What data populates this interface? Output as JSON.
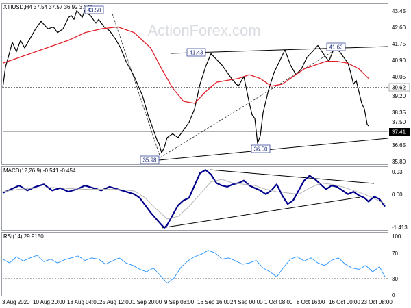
{
  "chart_data": {
    "type": "line",
    "watermark": "ActionForex.com",
    "x_tick_labels": [
      "3 Aug 2020",
      "10 Aug 20:00",
      "18 Aug 04:00",
      "25 Aug 12:00",
      "1 Sep 20:00",
      "9 Sep 08:00",
      "16 Sep 16:00",
      "24 Sep 00:00",
      "1 Oct 08:00",
      "8 Oct 16:00",
      "16 Oct 00:00",
      "23 Oct 08:00"
    ],
    "price_panel": {
      "header": "XTIUSD,H4  37.54 37.57 36.92 37.41",
      "ylim": [
        35.4,
        43.8
      ],
      "y_ticks": [
        "43.45",
        "42.60",
        "41.75",
        "40.90",
        "40.05",
        "39.20",
        "38.35",
        "37.50",
        "36.65",
        "35.80"
      ],
      "current_price_label": "37.41",
      "reference_level_label": "39.62",
      "annotations": [
        "43.50",
        "41.43",
        "41.63",
        "35.98",
        "36.50"
      ],
      "series": [
        {
          "color": "#000000",
          "x": [
            0,
            4,
            8,
            14,
            20,
            26,
            32,
            40,
            48,
            56,
            66,
            74,
            80,
            88,
            96,
            100,
            104,
            108,
            112,
            116,
            120,
            124,
            128,
            132,
            136,
            140,
            148,
            156,
            164,
            172,
            180,
            192,
            204,
            212,
            220,
            226,
            228,
            232,
            236,
            240,
            248,
            256,
            264,
            272,
            280,
            288,
            296,
            304,
            312,
            320,
            328,
            336,
            344,
            352,
            356,
            360,
            364,
            368,
            372,
            376,
            380,
            388,
            396,
            404,
            412,
            420,
            428,
            436,
            444,
            452,
            460,
            468,
            476,
            484,
            492,
            500,
            504,
            508,
            512,
            516,
            520,
            524,
            528,
            532,
            534
          ],
          "y": [
            39.4,
            40.5,
            41.0,
            41.8,
            41.3,
            41.9,
            41.5,
            42.0,
            42.5,
            42.9,
            42.5,
            42.6,
            42.3,
            42.5,
            43.1,
            43.2,
            43.0,
            43.45,
            43.3,
            43.1,
            43.5,
            43.3,
            43.2,
            43.0,
            42.8,
            43.0,
            42.6,
            42.4,
            42.0,
            41.5,
            40.8,
            40.0,
            39.0,
            38.0,
            37.2,
            36.6,
            36.5,
            36.0,
            36.3,
            36.8,
            37.0,
            36.8,
            37.2,
            37.6,
            38.3,
            39.6,
            40.5,
            41.2,
            40.9,
            40.6,
            40.2,
            39.8,
            39.5,
            40.0,
            39.3,
            38.6,
            38.0,
            37.8,
            36.5,
            36.9,
            38.1,
            39.3,
            40.2,
            40.8,
            41.4,
            40.6,
            40.1,
            40.4,
            41.0,
            41.3,
            41.63,
            41.2,
            40.8,
            41.5,
            41.3,
            40.9,
            40.7,
            40.2,
            39.6,
            39.8,
            39.2,
            38.6,
            38.3,
            37.5,
            37.41
          ]
        },
        {
          "color": "#e2202a",
          "x": [
            0,
            24,
            48,
            72,
            96,
            120,
            144,
            168,
            192,
            216,
            232,
            248,
            264,
            280,
            296,
            312,
            328,
            344,
            360,
            376,
            392,
            408,
            424,
            440,
            456,
            472,
            488,
            504,
            520,
            534
          ],
          "y": [
            40.7,
            41.0,
            41.3,
            41.6,
            41.9,
            42.3,
            42.5,
            42.6,
            42.3,
            41.5,
            40.4,
            39.4,
            38.7,
            38.6,
            39.2,
            39.7,
            39.8,
            39.9,
            40.1,
            39.9,
            39.5,
            39.6,
            40.0,
            40.4,
            40.6,
            40.8,
            40.8,
            40.7,
            40.4,
            39.9
          ]
        }
      ]
    },
    "macd_panel": {
      "header": "MACD(12,26,9) -0.541 -0.454",
      "ylim": [
        -1.5,
        1.05
      ],
      "y_ticks": [
        "0.93",
        "0.00",
        "-1.413"
      ],
      "series": [
        {
          "color": "#00008b",
          "x": [
            0,
            12,
            24,
            36,
            48,
            60,
            72,
            84,
            96,
            108,
            120,
            132,
            144,
            156,
            168,
            180,
            192,
            200,
            208,
            216,
            224,
            232,
            236,
            240,
            248,
            256,
            264,
            272,
            280,
            288,
            296,
            304,
            312,
            320,
            328,
            336,
            344,
            352,
            360,
            368,
            376,
            384,
            392,
            400,
            408,
            416,
            424,
            432,
            440,
            448,
            456,
            464,
            472,
            480,
            488,
            496,
            504,
            512,
            520,
            528,
            534,
            542,
            550,
            558
          ],
          "y": [
            0.0,
            0.15,
            0.3,
            0.1,
            0.25,
            0.35,
            0.1,
            0.2,
            0.05,
            0.15,
            0.3,
            0.2,
            0.1,
            0.25,
            0.15,
            0.05,
            -0.05,
            -0.2,
            -0.5,
            -0.8,
            -1.05,
            -1.3,
            -1.41,
            -1.3,
            -0.9,
            -0.5,
            -0.3,
            -0.2,
            0.3,
            0.8,
            0.93,
            0.75,
            0.4,
            0.3,
            0.25,
            0.35,
            0.4,
            0.5,
            0.3,
            0.2,
            0.1,
            -0.05,
            0.1,
            0.35,
            -0.1,
            -0.45,
            -0.3,
            0.1,
            0.5,
            0.7,
            0.55,
            0.35,
            0.15,
            0.3,
            0.25,
            0.1,
            -0.05,
            0.05,
            -0.1,
            -0.2,
            -0.35,
            -0.15,
            -0.25,
            -0.55
          ]
        },
        {
          "color": "#b5b5b5",
          "x": [
            0,
            24,
            48,
            72,
            96,
            120,
            144,
            168,
            192,
            208,
            224,
            240,
            256,
            272,
            288,
            304,
            320,
            336,
            352,
            368,
            384,
            400,
            416,
            432,
            448,
            464,
            480,
            496,
            512,
            528,
            544,
            558
          ],
          "y": [
            0.05,
            0.15,
            0.2,
            0.22,
            0.18,
            0.15,
            0.15,
            0.14,
            0.08,
            -0.2,
            -0.65,
            -1.05,
            -0.95,
            -0.55,
            -0.05,
            0.45,
            0.55,
            0.4,
            0.35,
            0.3,
            0.15,
            0.05,
            0.0,
            -0.05,
            0.2,
            0.4,
            0.35,
            0.25,
            0.1,
            -0.05,
            -0.25,
            -0.45
          ]
        }
      ]
    },
    "rsi_panel": {
      "header": "RSI(14) 29.9150",
      "ylim": [
        0,
        100
      ],
      "y_ticks": [
        "100",
        "70",
        "30",
        "0"
      ],
      "series": [
        {
          "color": "#1e90ff",
          "x": [
            0,
            10,
            20,
            30,
            40,
            50,
            60,
            70,
            80,
            90,
            100,
            110,
            120,
            130,
            140,
            150,
            160,
            170,
            180,
            190,
            200,
            210,
            220,
            230,
            240,
            250,
            260,
            270,
            280,
            290,
            300,
            310,
            320,
            330,
            340,
            350,
            360,
            370,
            380,
            390,
            400,
            410,
            420,
            430,
            440,
            450,
            460,
            470,
            480,
            490,
            500,
            510,
            520,
            530,
            540,
            550,
            558
          ],
          "y": [
            58,
            52,
            62,
            55,
            60,
            64,
            54,
            58,
            52,
            57,
            60,
            63,
            56,
            60,
            58,
            50,
            55,
            60,
            52,
            48,
            42,
            38,
            44,
            32,
            20,
            28,
            45,
            55,
            62,
            66,
            72,
            68,
            58,
            60,
            55,
            50,
            52,
            56,
            44,
            38,
            30,
            45,
            58,
            62,
            55,
            60,
            52,
            48,
            56,
            60,
            50,
            44,
            42,
            48,
            38,
            46,
            30
          ]
        }
      ]
    }
  }
}
